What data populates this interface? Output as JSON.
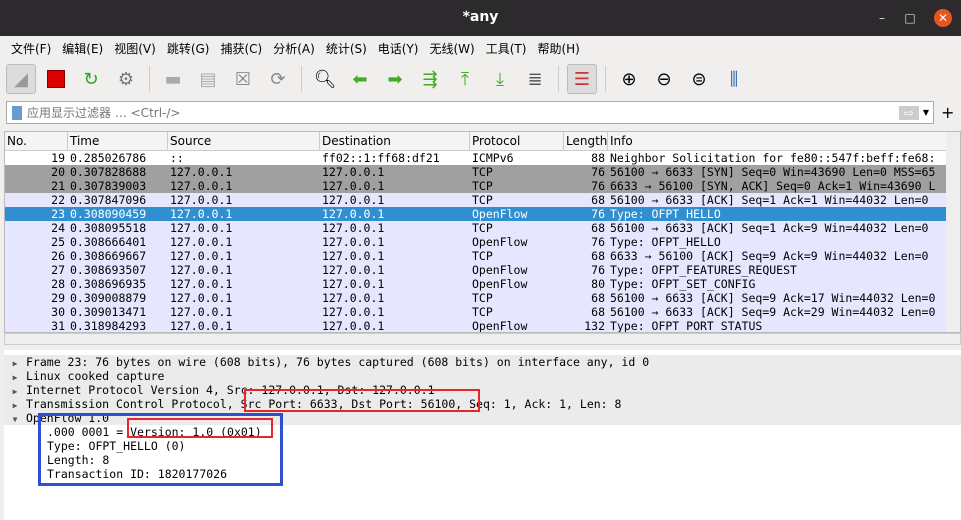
{
  "window": {
    "title": "*any",
    "min": "–",
    "max": "□",
    "close": "✕"
  },
  "menu": [
    "文件(F)",
    "编辑(E)",
    "视图(V)",
    "跳转(G)",
    "捕获(C)",
    "分析(A)",
    "统计(S)",
    "电话(Y)",
    "无线(W)",
    "工具(T)",
    "帮助(H)"
  ],
  "filter": {
    "placeholder": "应用显示过滤器 … <Ctrl-/>",
    "add": "+",
    "arrow": "⇨"
  },
  "columns": [
    "No.",
    "Time",
    "Source",
    "Destination",
    "Protocol",
    "Length",
    "Info"
  ],
  "packets": [
    [
      "19",
      "0.285026786",
      "::",
      "ff02::1:ff68:df21",
      "ICMPv6",
      "88",
      "Neighbor Solicitation for fe80::547f:beff:fe68:"
    ],
    [
      "20",
      "0.307828688",
      "127.0.0.1",
      "127.0.0.1",
      "TCP",
      "76",
      "56100 → 6633 [SYN] Seq=0 Win=43690 Len=0 MSS=65"
    ],
    [
      "21",
      "0.307839003",
      "127.0.0.1",
      "127.0.0.1",
      "TCP",
      "76",
      "6633 → 56100 [SYN, ACK] Seq=0 Ack=1 Win=43690 L"
    ],
    [
      "22",
      "0.307847096",
      "127.0.0.1",
      "127.0.0.1",
      "TCP",
      "68",
      "56100 → 6633 [ACK] Seq=1 Ack=1 Win=44032 Len=0"
    ],
    [
      "23",
      "0.308090459",
      "127.0.0.1",
      "127.0.0.1",
      "OpenFlow",
      "76",
      "Type: OFPT_HELLO"
    ],
    [
      "24",
      "0.308095518",
      "127.0.0.1",
      "127.0.0.1",
      "TCP",
      "68",
      "56100 → 6633 [ACK] Seq=1 Ack=9 Win=44032 Len=0"
    ],
    [
      "25",
      "0.308666401",
      "127.0.0.1",
      "127.0.0.1",
      "OpenFlow",
      "76",
      "Type: OFPT_HELLO"
    ],
    [
      "26",
      "0.308669667",
      "127.0.0.1",
      "127.0.0.1",
      "TCP",
      "68",
      "6633 → 56100 [ACK] Seq=9 Ack=9 Win=44032 Len=0"
    ],
    [
      "27",
      "0.308693507",
      "127.0.0.1",
      "127.0.0.1",
      "OpenFlow",
      "76",
      "Type: OFPT_FEATURES_REQUEST"
    ],
    [
      "28",
      "0.308696935",
      "127.0.0.1",
      "127.0.0.1",
      "OpenFlow",
      "80",
      "Type: OFPT_SET_CONFIG"
    ],
    [
      "29",
      "0.309008879",
      "127.0.0.1",
      "127.0.0.1",
      "TCP",
      "68",
      "56100 → 6633 [ACK] Seq=9 Ack=17 Win=44032 Len=0"
    ],
    [
      "30",
      "0.309013471",
      "127.0.0.1",
      "127.0.0.1",
      "TCP",
      "68",
      "56100 → 6633 [ACK] Seq=9 Ack=29 Win=44032 Len=0"
    ],
    [
      "31",
      "0.318984293",
      "127.0.0.1",
      "127.0.0.1",
      "OpenFlow",
      "132",
      "Type: OFPT_PORT_STATUS"
    ]
  ],
  "row_styles": [
    "white",
    "gray",
    "gray",
    "lav",
    "sel",
    "lav",
    "lav",
    "lav",
    "lav",
    "lav",
    "lav",
    "lav",
    "lav"
  ],
  "colors": {
    "white": "#ffffff",
    "gray": "#a0a0a0",
    "lav": "#e7e6ff",
    "sel": "#2f8fd0"
  },
  "details": {
    "frame": "Frame 23: 76 bytes on wire (608 bits), 76 bytes captured (608 bits) on interface any, id 0",
    "linux": "Linux cooked capture",
    "ip": "Internet Protocol Version 4, Src: 127.0.0.1, Dst: 127.0.0.1",
    "tcp_a": "Transmission Control Protocol, ",
    "tcp_b": "Src Port: 6633, Dst Port: 56100,",
    "tcp_c": " Seq: 1, Ack: 1, Len: 8",
    "of": "OpenFlow 1.0",
    "ver_a": ".000 0001 = ",
    "ver_b": "Version: 1.0 (0x01)",
    "type": "Type: OFPT_HELLO (0)",
    "length": "Length: 8",
    "xid": "Transaction ID: 1820177026"
  }
}
